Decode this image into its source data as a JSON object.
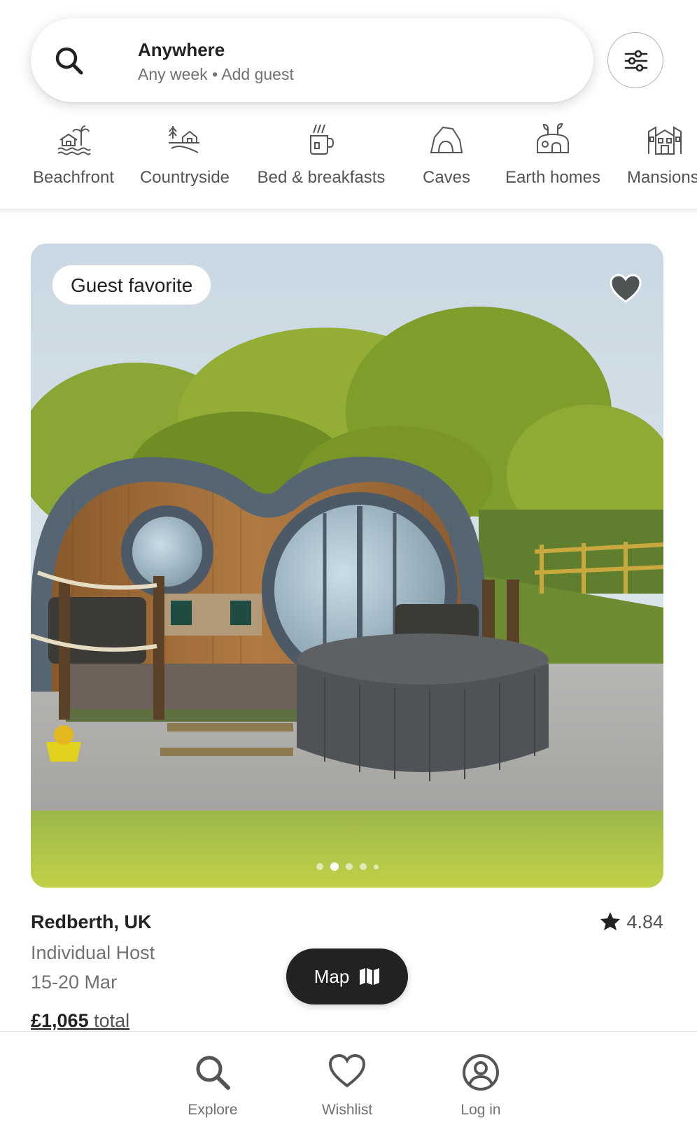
{
  "search": {
    "title": "Anywhere",
    "subtitle": "Any week • Add guest"
  },
  "icons": {
    "search": "search-icon",
    "filter": "sliders-icon"
  },
  "categories": [
    {
      "label": "Beachfront",
      "icon": "beach-house-icon"
    },
    {
      "label": "Countryside",
      "icon": "countryside-icon"
    },
    {
      "label": "Bed & breakfasts",
      "icon": "coffee-mug-icon"
    },
    {
      "label": "Caves",
      "icon": "cave-icon"
    },
    {
      "label": "Earth homes",
      "icon": "earth-home-icon"
    },
    {
      "label": "Mansions",
      "icon": "mansion-icon"
    }
  ],
  "listing": {
    "badge": "Guest favorite",
    "location": "Redberth, UK",
    "rating": "4.84",
    "host": "Individual Host",
    "dates": "15-20 Mar",
    "price": "£1,065",
    "price_suffix": "total",
    "photo_count": 5,
    "active_photo": 2
  },
  "map_button": {
    "label": "Map"
  },
  "tabs": [
    {
      "label": "Explore",
      "icon": "search-icon"
    },
    {
      "label": "Wishlist",
      "icon": "heart-icon"
    },
    {
      "label": "Log in",
      "icon": "user-circle-icon"
    }
  ],
  "colors": {
    "text": "#222222",
    "muted": "#717171",
    "button_dark": "#222222"
  }
}
